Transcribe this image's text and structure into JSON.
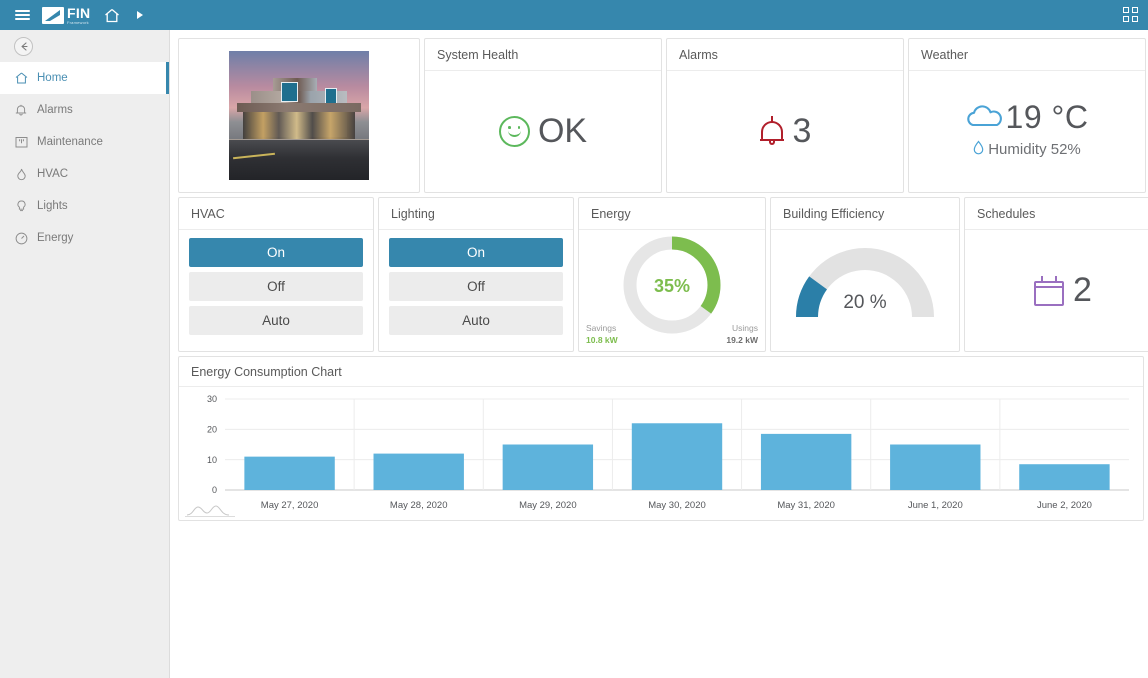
{
  "topbar": {
    "menu_icon": "hamburger-icon",
    "logo_title": "FIN",
    "logo_subtitle": "Framework",
    "home_icon": "home-icon",
    "forward_icon": "play-triangle-icon",
    "apps_icon": "apps-grid-icon"
  },
  "sidebar": {
    "back_label": "←",
    "items": [
      {
        "label": "Home",
        "icon": "home-icon",
        "active": true
      },
      {
        "label": "Alarms",
        "icon": "bell-icon",
        "active": false
      },
      {
        "label": "Maintenance",
        "icon": "toolbox-icon",
        "active": false
      },
      {
        "label": "HVAC",
        "icon": "flame-icon",
        "active": false
      },
      {
        "label": "Lights",
        "icon": "bulb-icon",
        "active": false
      },
      {
        "label": "Energy",
        "icon": "gauge-icon",
        "active": false
      }
    ]
  },
  "cards": {
    "building_image": {
      "name": "building-photo",
      "alt": "Storefront building at dusk"
    },
    "system_health": {
      "title": "System Health",
      "value": "OK",
      "icon": "smiley-face-icon",
      "color": "#5cb85c"
    },
    "alarms": {
      "title": "Alarms",
      "value": "3",
      "icon": "bell-icon",
      "color": "#b11f2b"
    },
    "weather": {
      "title": "Weather",
      "temperature": "19 °C",
      "humidity": "Humidity 52%",
      "cloud_icon": "cloud-icon",
      "drop_icon": "water-drop-icon",
      "color": "#4aa3d6"
    },
    "hvac": {
      "title": "HVAC",
      "buttons": [
        {
          "label": "On",
          "active": true
        },
        {
          "label": "Off",
          "active": false
        },
        {
          "label": "Auto",
          "active": false
        }
      ]
    },
    "lighting": {
      "title": "Lighting",
      "buttons": [
        {
          "label": "On",
          "active": true
        },
        {
          "label": "Off",
          "active": false
        },
        {
          "label": "Auto",
          "active": false
        }
      ]
    },
    "energy": {
      "title": "Energy",
      "percent_label": "35%",
      "percent_value": 35,
      "savings_caption": "Savings",
      "savings_value": "10.8 kW",
      "usings_caption": "Usings",
      "usings_value": "19.2 kW",
      "arc_color": "#7dbd4e",
      "track_color": "#e6e6e6"
    },
    "building_efficiency": {
      "title": "Building Efficiency",
      "value_label": "20 %",
      "percent_value": 20,
      "arc_color": "#2b7fa8",
      "track_color": "#e2e2e2"
    },
    "schedules": {
      "title": "Schedules",
      "value": "2",
      "icon": "calendar-icon",
      "color": "#9a6fc0"
    }
  },
  "chart_data": {
    "type": "bar",
    "title": "Energy Consumption Chart",
    "categories": [
      "May 27, 2020",
      "May 28, 2020",
      "May 29, 2020",
      "May 30, 2020",
      "May 31, 2020",
      "June 1, 2020",
      "June 2, 2020"
    ],
    "values": [
      11,
      12,
      15,
      22,
      18.5,
      15,
      8.5
    ],
    "yticks": [
      0,
      10,
      20,
      30
    ],
    "ylim": [
      0,
      30
    ],
    "xlabel": "",
    "ylabel": "",
    "grid": true,
    "legend": false,
    "bar_color": "#5eb3dc"
  }
}
